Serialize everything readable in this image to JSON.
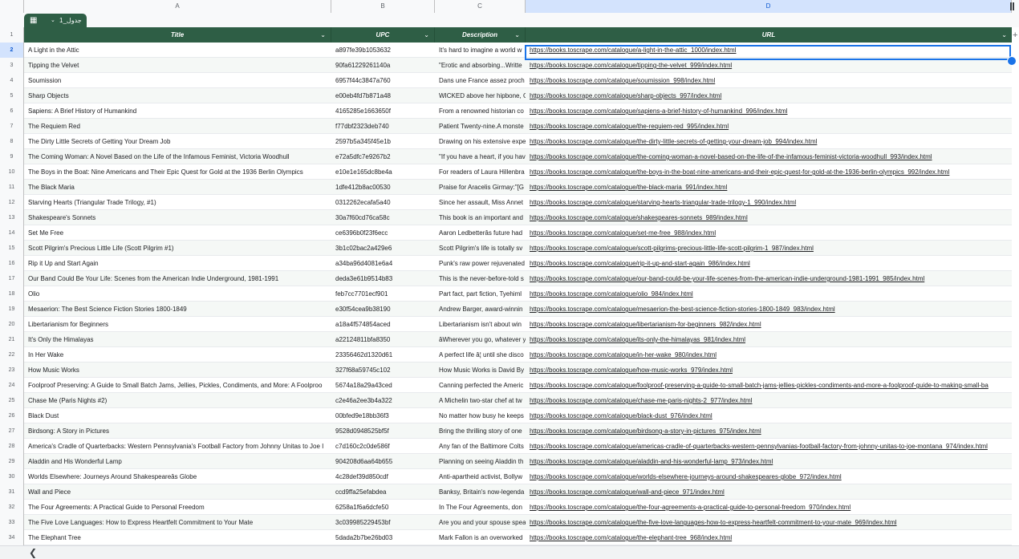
{
  "sheet": {
    "table_name": "جدول_1",
    "columns": [
      "A",
      "B",
      "C",
      "D"
    ],
    "headers": [
      "Title",
      "UPC",
      "Description",
      "URL"
    ],
    "selected_cell": {
      "row": "2",
      "column": "D"
    },
    "rows": [
      {
        "n": "2",
        "title": "A Light in the Attic",
        "upc": "a897fe39b1053632",
        "desc": "It's hard to imagine a world w",
        "url": "https://books.toscrape.com/catalogue/a-light-in-the-attic_1000/index.html"
      },
      {
        "n": "3",
        "title": "Tipping the Velvet",
        "upc": "90fa61229261140a",
        "desc": "\"Erotic and absorbing...Writte",
        "url": "https://books.toscrape.com/catalogue/tipping-the-velvet_999/index.html"
      },
      {
        "n": "4",
        "title": "Soumission",
        "upc": "6957f44c3847a760",
        "desc": "Dans une France assez proch",
        "url": "https://books.toscrape.com/catalogue/soumission_998/index.html"
      },
      {
        "n": "5",
        "title": "Sharp Objects",
        "upc": "e00eb4fd7b871a48",
        "desc": "WICKED above her hipbone, G",
        "url": "https://books.toscrape.com/catalogue/sharp-objects_997/index.html"
      },
      {
        "n": "6",
        "title": "Sapiens: A Brief History of Humankind",
        "upc": "4165285e1663650f",
        "desc": "From a renowned historian co",
        "url": "https://books.toscrape.com/catalogue/sapiens-a-brief-history-of-humankind_996/index.html"
      },
      {
        "n": "7",
        "title": "The Requiem Red",
        "upc": "f77dbf2323deb740",
        "desc": "Patient Twenty-nine.A monste",
        "url": "https://books.toscrape.com/catalogue/the-requiem-red_995/index.html"
      },
      {
        "n": "8",
        "title": "The Dirty Little Secrets of Getting Your Dream Job",
        "upc": "2597b5a345f45e1b",
        "desc": "Drawing on his extensive expe",
        "url": "https://books.toscrape.com/catalogue/the-dirty-little-secrets-of-getting-your-dream-job_994/index.html"
      },
      {
        "n": "9",
        "title": "The Coming Woman: A Novel Based on the Life of the Infamous Feminist, Victoria Woodhull",
        "upc": "e72a5dfc7e9267b2",
        "desc": "\"If you have a heart, if you hav",
        "url": "https://books.toscrape.com/catalogue/the-coming-woman-a-novel-based-on-the-life-of-the-infamous-feminist-victoria-woodhull_993/index.html"
      },
      {
        "n": "10",
        "title": "The Boys in the Boat: Nine Americans and Their Epic Quest for Gold at the 1936 Berlin Olympics",
        "upc": "e10e1e165dc8be4a",
        "desc": "For readers of Laura Hillenbra",
        "url": "https://books.toscrape.com/catalogue/the-boys-in-the-boat-nine-americans-and-their-epic-quest-for-gold-at-the-1936-berlin-olympics_992/index.html"
      },
      {
        "n": "11",
        "title": "The Black Maria",
        "upc": "1dfe412b8ac00530",
        "desc": "Praise for Aracelis Girmay:\"[G",
        "url": "https://books.toscrape.com/catalogue/the-black-maria_991/index.html"
      },
      {
        "n": "12",
        "title": "Starving Hearts (Triangular Trade Trilogy, #1)",
        "upc": "0312262ecafa5a40",
        "desc": "Since her assault, Miss Annet",
        "url": "https://books.toscrape.com/catalogue/starving-hearts-triangular-trade-trilogy-1_990/index.html"
      },
      {
        "n": "13",
        "title": "Shakespeare's Sonnets",
        "upc": "30a7f60cd76ca58c",
        "desc": "This book is an important and",
        "url": "https://books.toscrape.com/catalogue/shakespeares-sonnets_989/index.html"
      },
      {
        "n": "14",
        "title": "Set Me Free",
        "upc": "ce6396b0f23f6ecc",
        "desc": "Aaron Ledbetterâs future had",
        "url": "https://books.toscrape.com/catalogue/set-me-free_988/index.html"
      },
      {
        "n": "15",
        "title": "Scott Pilgrim's Precious Little Life (Scott Pilgrim #1)",
        "upc": "3b1c02bac2a429e6",
        "desc": "Scott Pilgrim's life is totally sv",
        "url": "https://books.toscrape.com/catalogue/scott-pilgrims-precious-little-life-scott-pilgrim-1_987/index.html"
      },
      {
        "n": "16",
        "title": "Rip it Up and Start Again",
        "upc": "a34ba96d4081e6a4",
        "desc": "Punk's raw power rejuvenated",
        "url": "https://books.toscrape.com/catalogue/rip-it-up-and-start-again_986/index.html"
      },
      {
        "n": "17",
        "title": "Our Band Could Be Your Life: Scenes from the American Indie Underground, 1981-1991",
        "upc": "deda3e61b9514b83",
        "desc": "This is the never-before-told s",
        "url": "https://books.toscrape.com/catalogue/our-band-could-be-your-life-scenes-from-the-american-indie-underground-1981-1991_985/index.html"
      },
      {
        "n": "18",
        "title": "Olio",
        "upc": "feb7cc7701ecf901",
        "desc": "Part fact, part fiction, Tyehiml",
        "url": "https://books.toscrape.com/catalogue/olio_984/index.html"
      },
      {
        "n": "19",
        "title": "Mesaerion: The Best Science Fiction Stories 1800-1849",
        "upc": "e30f54cea9b38190",
        "desc": "Andrew Barger, award-winnin",
        "url": "https://books.toscrape.com/catalogue/mesaerion-the-best-science-fiction-stories-1800-1849_983/index.html"
      },
      {
        "n": "20",
        "title": "Libertarianism for Beginners",
        "upc": "a18a4f574854aced",
        "desc": "Libertarianism isn't about win",
        "url": "https://books.toscrape.com/catalogue/libertarianism-for-beginners_982/index.html"
      },
      {
        "n": "21",
        "title": "It's Only the Himalayas",
        "upc": "a22124811bfa8350",
        "desc": "âWherever you go, whatever y",
        "url": "https://books.toscrape.com/catalogue/its-only-the-himalayas_981/index.html"
      },
      {
        "n": "22",
        "title": "In Her Wake",
        "upc": "23356462d1320d61",
        "desc": "A perfect life â¦ until she disco",
        "url": "https://books.toscrape.com/catalogue/in-her-wake_980/index.html"
      },
      {
        "n": "23",
        "title": "How Music Works",
        "upc": "327f68a59745c102",
        "desc": "How Music Works is David By",
        "url": "https://books.toscrape.com/catalogue/how-music-works_979/index.html"
      },
      {
        "n": "24",
        "title": "Foolproof Preserving: A Guide to Small Batch Jams, Jellies, Pickles, Condiments, and More: A Foolproo",
        "upc": "5674a18a29a43ced",
        "desc": "Canning perfected the Americ",
        "url": "https://books.toscrape.com/catalogue/foolproof-preserving-a-guide-to-small-batch-jams-jellies-pickles-condiments-and-more-a-foolproof-guide-to-making-small-ba"
      },
      {
        "n": "25",
        "title": "Chase Me (Paris Nights #2)",
        "upc": "c2e46a2ee3b4a322",
        "desc": "A Michelin two-star chef at tw",
        "url": "https://books.toscrape.com/catalogue/chase-me-paris-nights-2_977/index.html"
      },
      {
        "n": "26",
        "title": "Black Dust",
        "upc": "00bfed9e18bb36f3",
        "desc": "No matter how busy he keeps",
        "url": "https://books.toscrape.com/catalogue/black-dust_976/index.html"
      },
      {
        "n": "27",
        "title": "Birdsong: A Story in Pictures",
        "upc": "9528d0948525bf5f",
        "desc": "Bring the thrilling story of one",
        "url": "https://books.toscrape.com/catalogue/birdsong-a-story-in-pictures_975/index.html"
      },
      {
        "n": "28",
        "title": "America's Cradle of Quarterbacks: Western Pennsylvania's Football Factory from Johnny Unitas to Joe I",
        "upc": "c7d160c2c0de586f",
        "desc": "Any fan of the Baltimore Colts",
        "url": "https://books.toscrape.com/catalogue/americas-cradle-of-quarterbacks-western-pennsylvanias-football-factory-from-johnny-unitas-to-joe-montana_974/index.html"
      },
      {
        "n": "29",
        "title": "Aladdin and His Wonderful Lamp",
        "upc": "904208d6aa64b655",
        "desc": "Planning on seeing Aladdin th",
        "url": "https://books.toscrape.com/catalogue/aladdin-and-his-wonderful-lamp_973/index.html"
      },
      {
        "n": "30",
        "title": "Worlds Elsewhere: Journeys Around Shakespeareâs Globe",
        "upc": "4c28def39d850cdf",
        "desc": "Anti-apartheid activist, Bollyw",
        "url": "https://books.toscrape.com/catalogue/worlds-elsewhere-journeys-around-shakespeares-globe_972/index.html"
      },
      {
        "n": "31",
        "title": "Wall and Piece",
        "upc": "ccd9ffa25efabdea",
        "desc": "Banksy, Britain's now-legenda",
        "url": "https://books.toscrape.com/catalogue/wall-and-piece_971/index.html"
      },
      {
        "n": "32",
        "title": "The Four Agreements: A Practical Guide to Personal Freedom",
        "upc": "6258a1f6a6dcfe50",
        "desc": "In The Four Agreements, don",
        "url": "https://books.toscrape.com/catalogue/the-four-agreements-a-practical-guide-to-personal-freedom_970/index.html"
      },
      {
        "n": "33",
        "title": "The Five Love Languages: How to Express Heartfelt Commitment to Your Mate",
        "upc": "3c039985229453bf",
        "desc": "Are you and your spouse spea",
        "url": "https://books.toscrape.com/catalogue/the-five-love-languages-how-to-express-heartfelt-commitment-to-your-mate_969/index.html"
      },
      {
        "n": "34",
        "title": "The Elephant Tree",
        "upc": "5dada2b7be26bd03",
        "desc": "Mark Fallon is an overworked",
        "url": "https://books.toscrape.com/catalogue/the-elephant-tree_968/index.html"
      }
    ]
  },
  "icons": {
    "table": "▦",
    "chevron_down": "⌄",
    "plus": "+",
    "scroll_left": "❮"
  }
}
